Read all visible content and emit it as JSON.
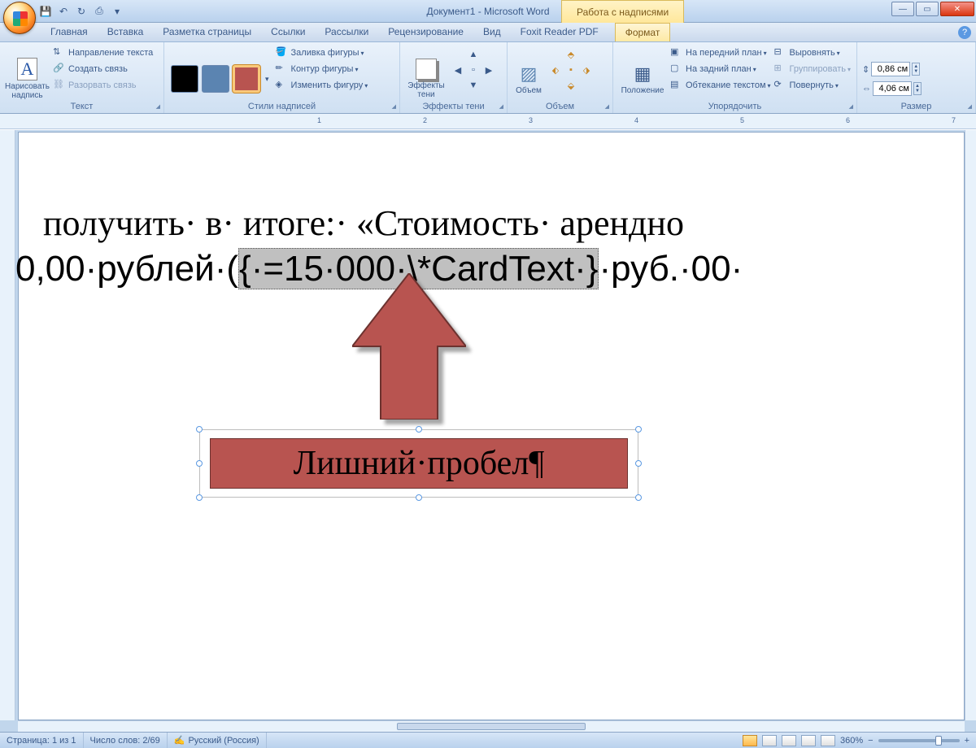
{
  "app_title": "Документ1 - Microsoft Word",
  "context_tab_title": "Работа с надписями",
  "qat": {
    "save": "💾",
    "undo": "↶",
    "redo": "↻",
    "print": "⎙"
  },
  "tabs": {
    "home": "Главная",
    "insert": "Вставка",
    "layout": "Разметка страницы",
    "refs": "Ссылки",
    "mail": "Рассылки",
    "review": "Рецензирование",
    "view": "Вид",
    "foxit": "Foxit Reader PDF",
    "format": "Формат"
  },
  "ribbon": {
    "text_group": "Текст",
    "draw_textbox": "Нарисовать\nнадпись",
    "text_direction": "Направление текста",
    "create_link": "Создать связь",
    "break_link": "Разорвать связь",
    "styles_group": "Стили надписей",
    "shape_fill": "Заливка фигуры",
    "shape_outline": "Контур фигуры",
    "change_shape": "Изменить фигуру",
    "shadow_group": "Эффекты тени",
    "shadow_effects": "Эффекты\nтени",
    "volume_group": "Объем",
    "volume": "Объем",
    "arrange_group": "Упорядочить",
    "position": "Положение",
    "bring_front": "На передний план",
    "send_back": "На задний план",
    "text_wrap": "Обтекание текстом",
    "align": "Выровнять",
    "group_btn": "Группировать",
    "rotate": "Повернуть",
    "size_group": "Размер",
    "height": "0,86 см",
    "width": "4,06 см"
  },
  "colors": {
    "black": "#000000",
    "blue": "#5b84b1",
    "red": "#b85450"
  },
  "ruler_marks": [
    "1",
    "2",
    "3",
    "4",
    "5",
    "6",
    "7"
  ],
  "document": {
    "line1_a": "получить· в· итоге:· «Стоимость· арендно",
    "line2_a": "0,00·рублей·(",
    "line2_field": "{·=15·000·\\*CardText·}",
    "line2_b": "·руб.·00·",
    "textbox": "Лишний·пробел¶"
  },
  "status": {
    "page": "Страница: 1 из 1",
    "words": "Число слов: 2/69",
    "lang": "Русский (Россия)",
    "zoom": "360%"
  }
}
